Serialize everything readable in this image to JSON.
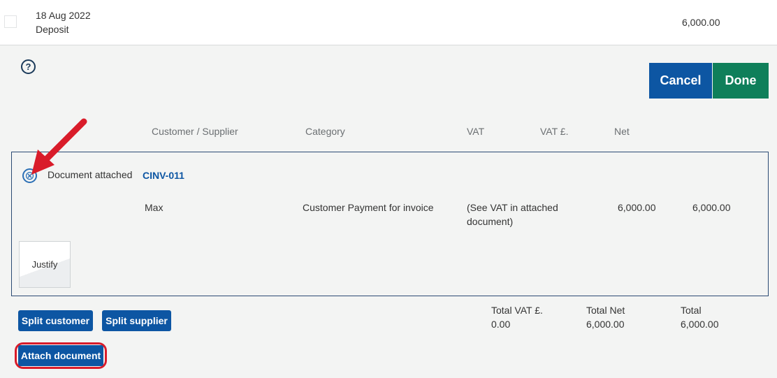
{
  "transaction": {
    "date": "18 Aug 2022",
    "type": "Deposit",
    "amount": "6,000.00"
  },
  "help": {
    "glyph": "?"
  },
  "actions": {
    "cancel_label": "Cancel",
    "done_label": "Done"
  },
  "columns": {
    "customer_supplier": "Customer / Supplier",
    "category": "Category",
    "vat": "VAT",
    "vat_amount": "VAT £.",
    "net": "Net"
  },
  "split": {
    "attachment_status": "Document attached",
    "document_ref": "CINV-011",
    "remove_glyph": "⊗",
    "row": {
      "customer": "Max",
      "category": "Customer Payment for invoice",
      "vat_line1": "(See VAT in attached",
      "vat_line2": "document)",
      "vat_amount": "6,000.00",
      "net": "6,000.00"
    },
    "justify_label": "Justify"
  },
  "buttons": {
    "split_customer": "Split customer",
    "split_supplier": "Split supplier",
    "attach_document": "Attach document"
  },
  "totals": {
    "total_vat_label": "Total VAT £.",
    "total_vat_value": "0.00",
    "total_net_label": "Total Net",
    "total_net_value": "6,000.00",
    "total_label": "Total",
    "total_value": "6,000.00"
  },
  "colors": {
    "primary_blue": "#0d56a3",
    "done_green": "#0f7f5a",
    "annotation_red": "#d91c2a",
    "background": "#f3f4f3"
  },
  "icons": {
    "help": "help-circle-icon",
    "remove": "remove-circle-icon",
    "annotation": "red-arrow-icon"
  }
}
